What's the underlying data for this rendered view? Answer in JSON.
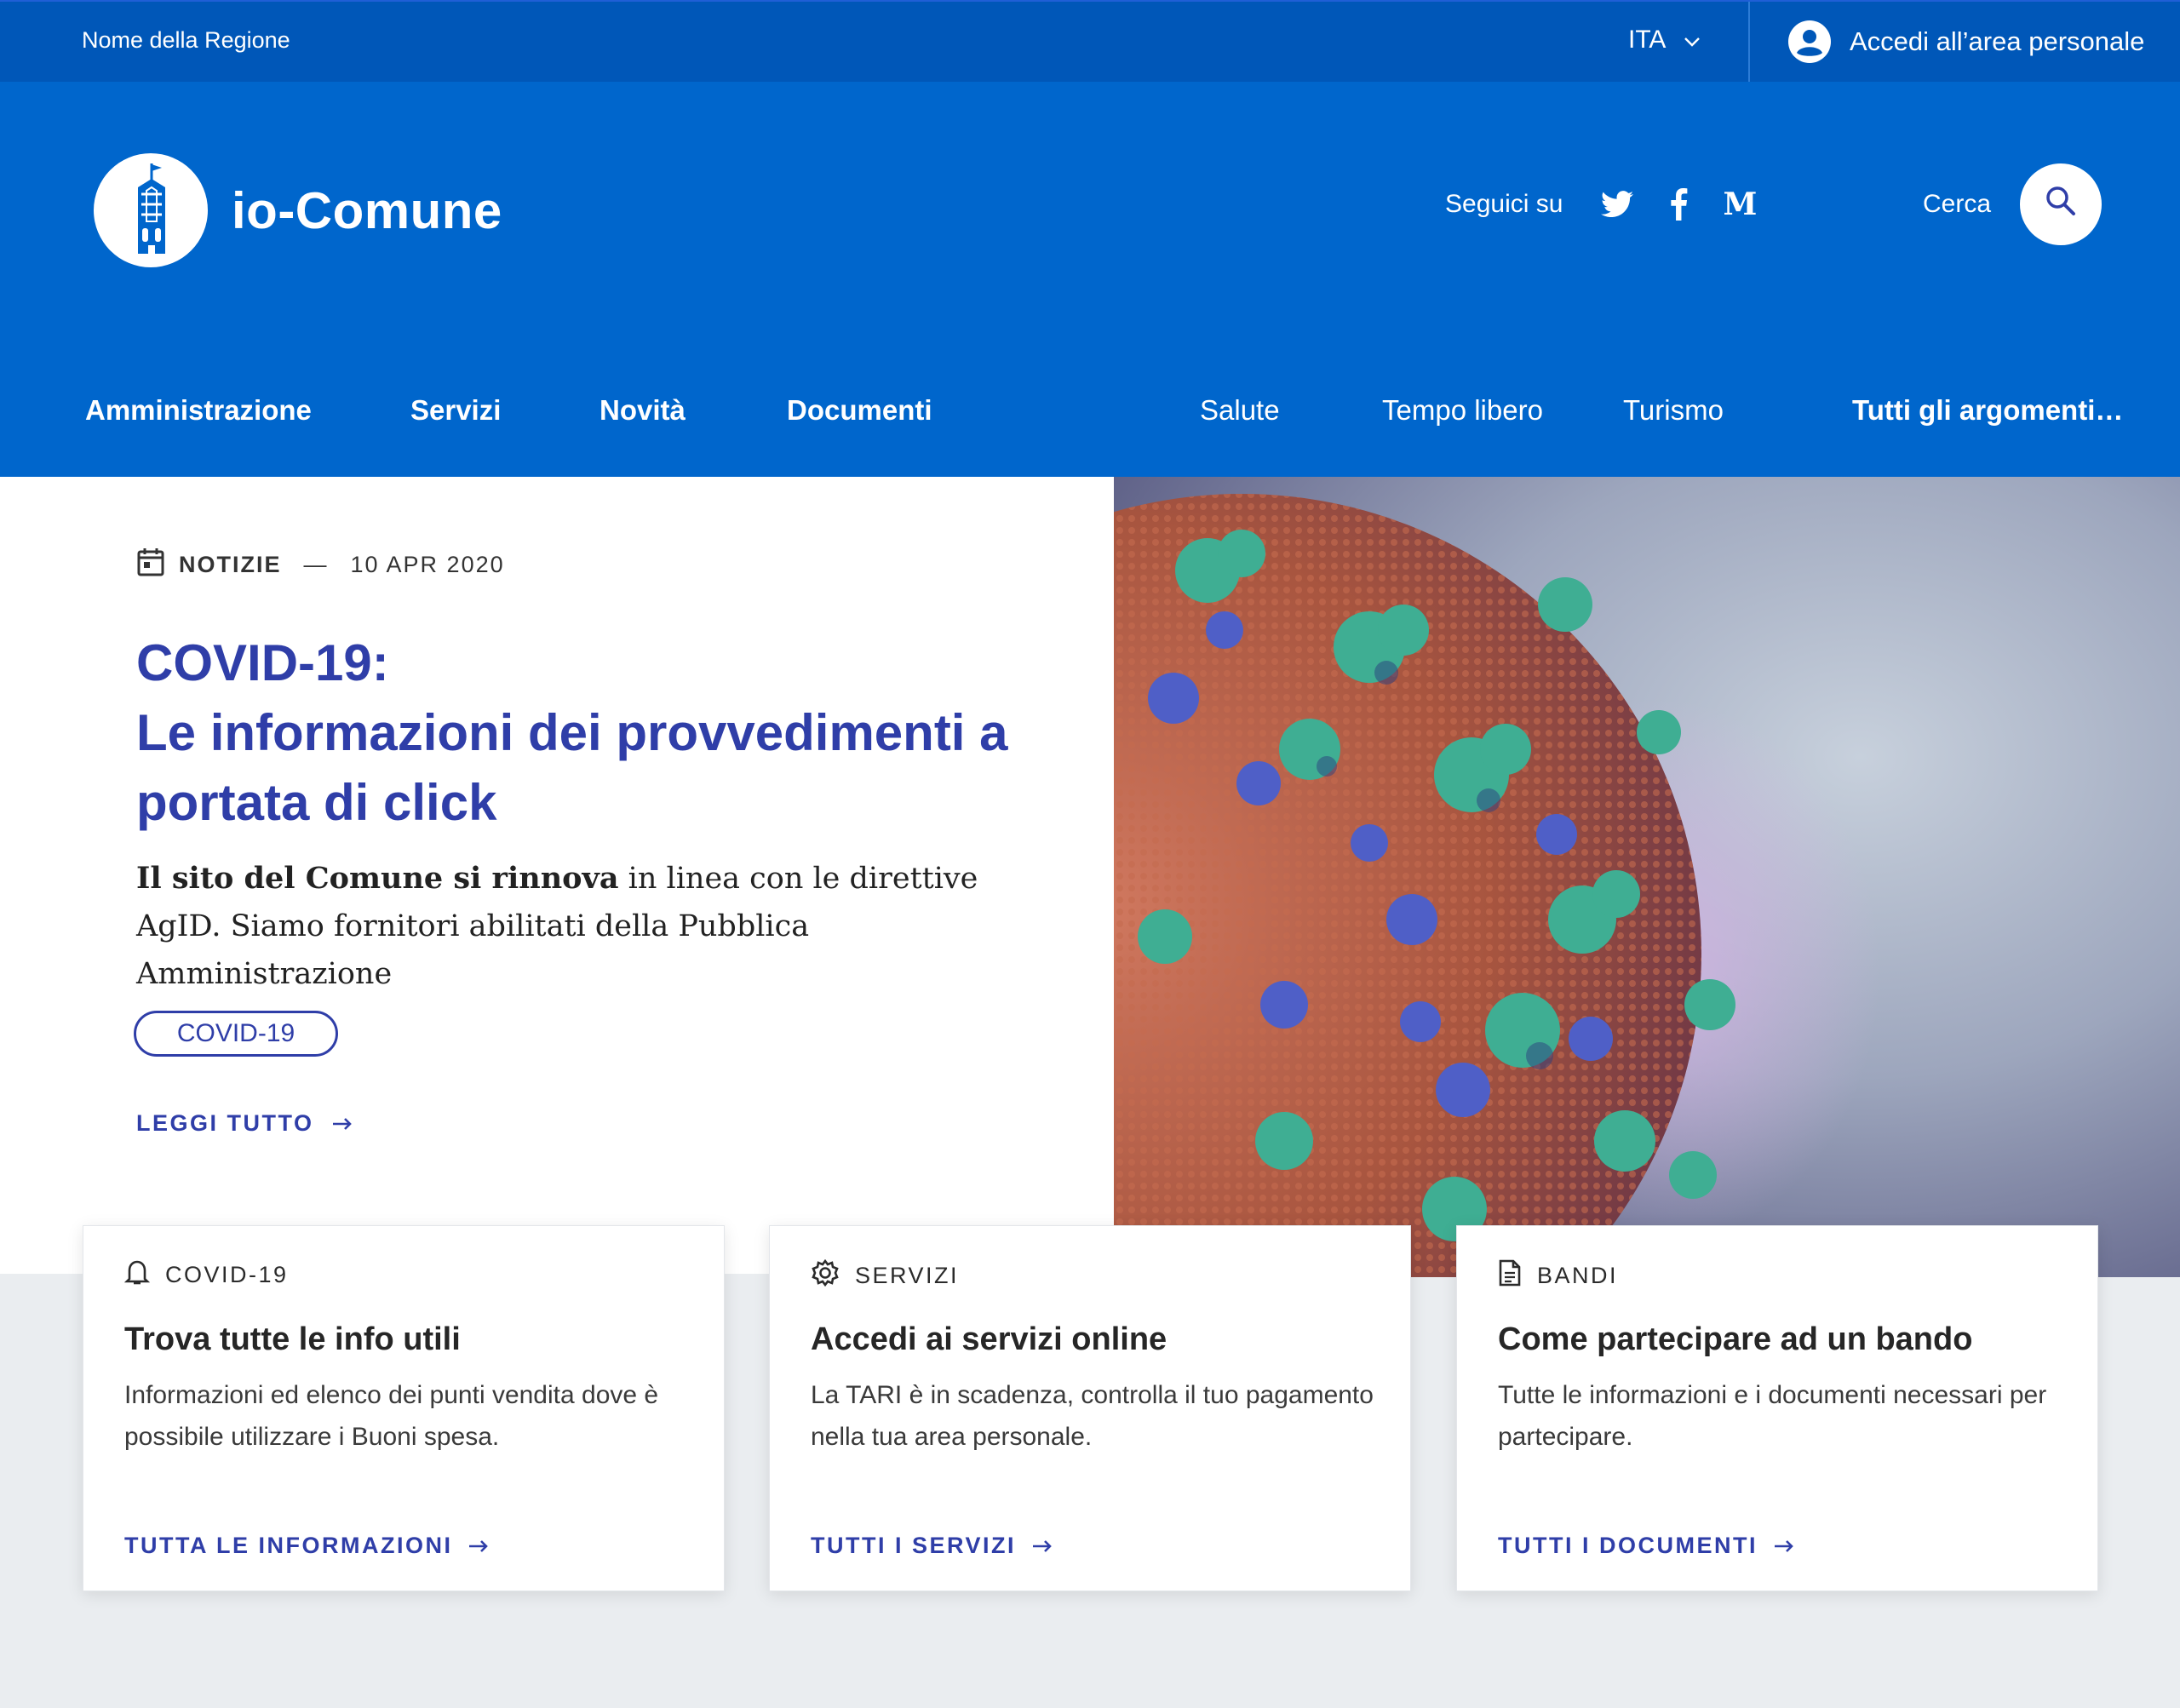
{
  "slim_header": {
    "region_name": "Nome della Regione",
    "language": "ITA",
    "login_label": "Accedi all’area personale"
  },
  "header": {
    "site_name": "io-Comune",
    "follow_label": "Seguici su",
    "social_icons": [
      "twitter-icon",
      "facebook-icon",
      "medium-icon"
    ],
    "search_label": "Cerca"
  },
  "nav": {
    "main": [
      "Amministrazione",
      "Servizi",
      "Novità",
      "Documenti"
    ],
    "topics": [
      "Salute",
      "Tempo libero",
      "Turismo"
    ],
    "all_topics": "Tutti gli argomenti…"
  },
  "hero": {
    "category": "NOTIZIE",
    "separator": "—",
    "date": "10 APR 2020",
    "title_line1": "COVID-19:",
    "title_line2": "Le informazioni dei provvedimenti a portata di click",
    "text_bold": "Il sito del Comune si rinnova",
    "text_rest": " in linea con le direttive AgID. Siamo fornitori abilitati della Pubblica Amministrazione",
    "chip": "COVID-19",
    "read_more": "LEGGI TUTTO"
  },
  "cards": [
    {
      "category": "COVID-19",
      "icon": "bell-icon",
      "title": "Trova tutte le info utili",
      "text": "Informazioni ed elenco dei punti vendita dove è possibile utilizzare i Buoni spesa.",
      "link": "TUTTA LE INFORMAZIONI"
    },
    {
      "category": "SERVIZI",
      "icon": "gear-icon",
      "title": "Accedi ai servizi online",
      "text": "La TARI è in scadenza, controlla il tuo pagamento nella tua area personale.",
      "link": "TUTTI I SERVIZI"
    },
    {
      "category": "BANDI",
      "icon": "document-icon",
      "title": "Come partecipare ad un bando",
      "text": "Tutte le informazioni e i documenti necessari per partecipare.",
      "link": "TUTTI I DOCUMENTI"
    }
  ],
  "colors": {
    "slim_header": "#0057b8",
    "header": "#0066cc",
    "accent": "#2f3ea8",
    "page_bg": "#eaedf0"
  }
}
